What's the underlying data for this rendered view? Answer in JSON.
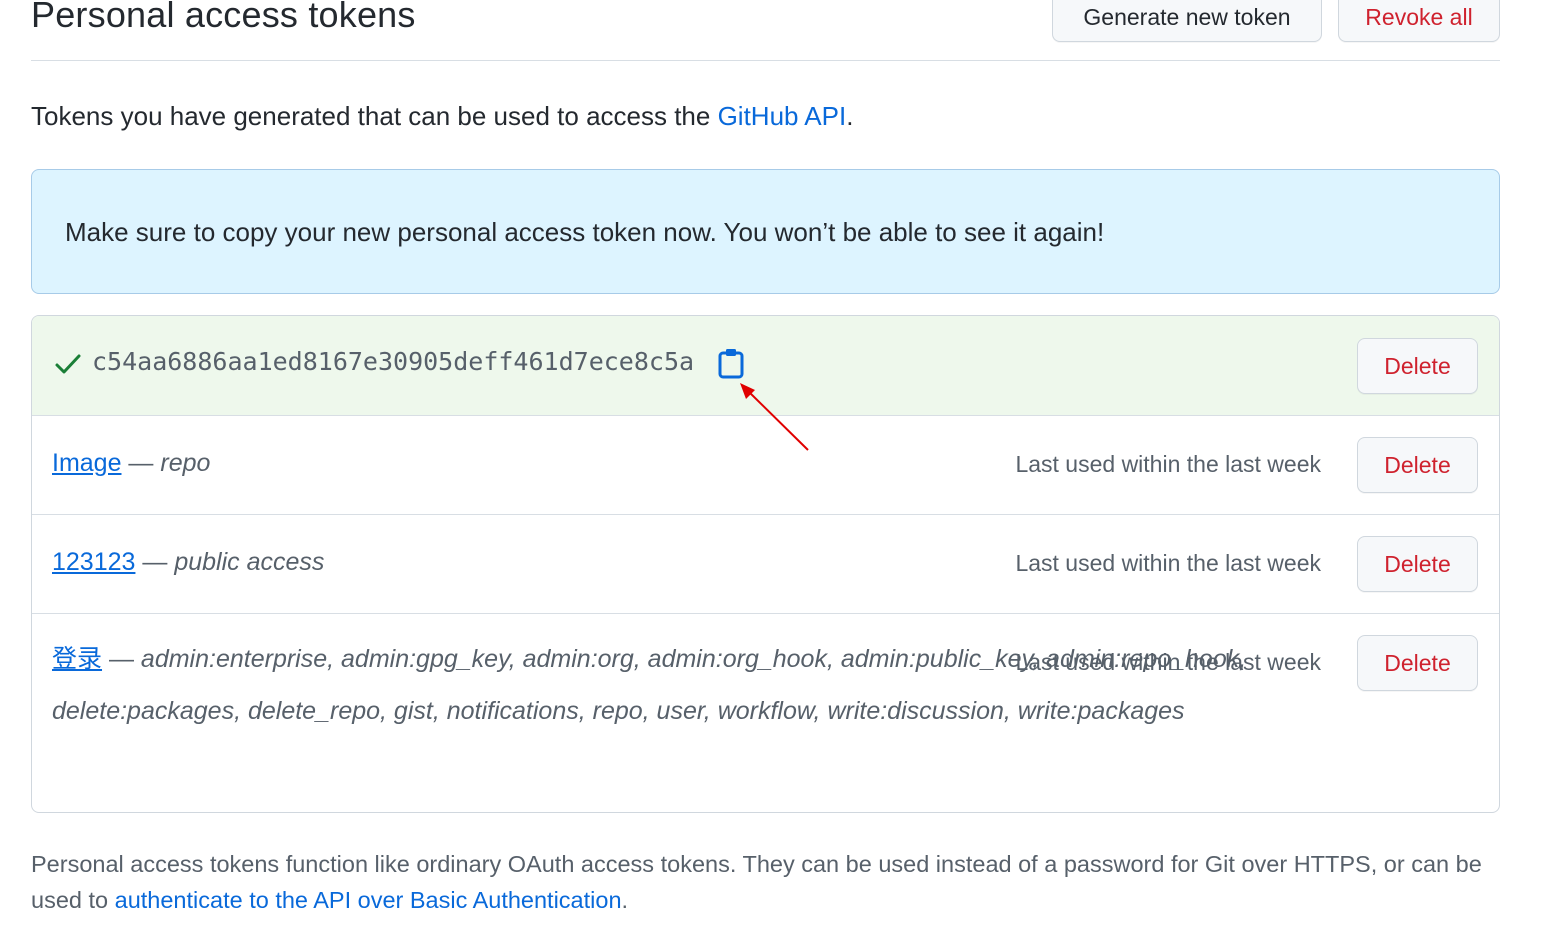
{
  "header": {
    "title": "Personal access tokens",
    "generate_label": "Generate new token",
    "revoke_label": "Revoke all"
  },
  "intro": {
    "text": "Tokens you have generated that can be used to access the ",
    "link": "GitHub API",
    "suffix": "."
  },
  "flash": {
    "message": "Make sure to copy your new personal access token now. You won’t be able to see it again!"
  },
  "new_token": {
    "value": "c54aa6886aa1ed8167e30905deff461d7ece8c5a",
    "delete_label": "Delete",
    "check_icon": "check-icon",
    "copy_icon": "clipboard-icon"
  },
  "tokens": [
    {
      "name": "Image",
      "separator": " — ",
      "scopes": "repo",
      "last_used": "Last used within the last week",
      "delete_label": "Delete"
    },
    {
      "name": "123123",
      "separator": " — ",
      "scopes": "public access",
      "last_used": "Last used within the last week",
      "delete_label": "Delete"
    },
    {
      "name": "登录",
      "separator": " — ",
      "scopes": "admin:enterprise, admin:gpg_key, admin:org, admin:org_hook, admin:public_key, admin:repo_hook, delete:packages, delete_repo, gist, notifications, repo, user, workflow, write:discussion, write:packages",
      "last_used": "Last used within the last week",
      "delete_label": "Delete"
    }
  ],
  "footer": {
    "text": "Personal access tokens function like ordinary OAuth access tokens. They can be used instead of a password for Git over HTTPS, or can be used to ",
    "link": "authenticate to the API over Basic Authentication",
    "suffix": "."
  },
  "colors": {
    "link": "#0969da",
    "danger": "#cf222e",
    "success": "#1a7f37",
    "flash_bg": "#ddf4ff",
    "new_token_bg": "#eef8ec",
    "annotation_arrow": "#e00000"
  }
}
